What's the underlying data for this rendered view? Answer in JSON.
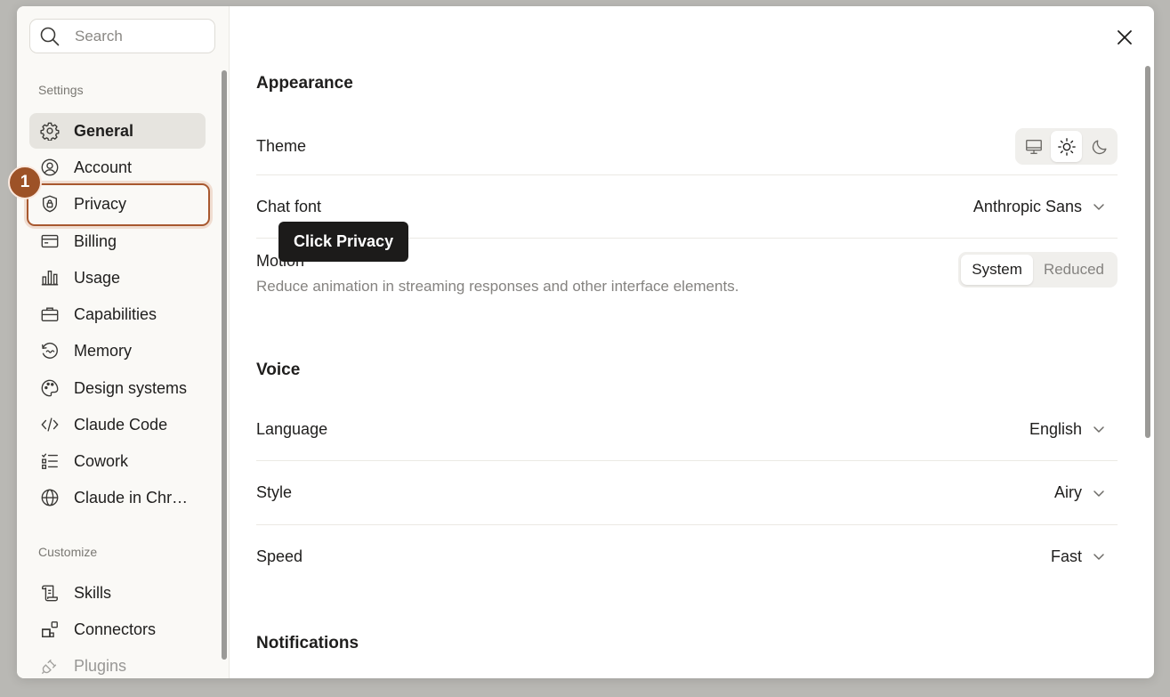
{
  "sidebar": {
    "search_placeholder": "Search",
    "settings_label": "Settings",
    "customize_label": "Customize",
    "settings_items": [
      {
        "label": "General",
        "icon": "gear-icon",
        "active": true
      },
      {
        "label": "Account",
        "icon": "user-circle-icon"
      },
      {
        "label": "Privacy",
        "icon": "shield-lock-icon"
      },
      {
        "label": "Billing",
        "icon": "credit-card-icon"
      },
      {
        "label": "Usage",
        "icon": "bar-chart-icon"
      },
      {
        "label": "Capabilities",
        "icon": "briefcase-icon"
      },
      {
        "label": "Memory",
        "icon": "memory-icon"
      },
      {
        "label": "Design systems",
        "icon": "palette-icon"
      },
      {
        "label": "Claude Code",
        "icon": "code-icon"
      },
      {
        "label": "Cowork",
        "icon": "checklist-icon"
      },
      {
        "label": "Claude in Chr…",
        "icon": "globe-icon"
      }
    ],
    "customize_items": [
      {
        "label": "Skills",
        "icon": "scroll-icon"
      },
      {
        "label": "Connectors",
        "icon": "blocks-icon"
      },
      {
        "label": "Plugins",
        "icon": "plug-icon"
      }
    ]
  },
  "annotation": {
    "step_number": "1",
    "tooltip": "Click Privacy"
  },
  "main": {
    "appearance": {
      "heading": "Appearance",
      "theme_label": "Theme",
      "theme_options": [
        "monitor-icon",
        "sun-icon",
        "moon-icon"
      ],
      "theme_selected": "sun-icon",
      "chat_font_label": "Chat font",
      "chat_font_value": "Anthropic Sans",
      "motion_label": "Motion",
      "motion_desc": "Reduce animation in streaming responses and other interface elements.",
      "motion_options": [
        "System",
        "Reduced"
      ],
      "motion_selected": "System"
    },
    "voice": {
      "heading": "Voice",
      "language_label": "Language",
      "language_value": "English",
      "style_label": "Style",
      "style_value": "Airy",
      "speed_label": "Speed",
      "speed_value": "Fast"
    },
    "notifications": {
      "heading": "Notifications"
    }
  },
  "colors": {
    "accent": "#a8582f",
    "badge": "#9d5227",
    "tooltip_bg": "#1c1b1a",
    "active_item_bg": "#e6e4df"
  }
}
